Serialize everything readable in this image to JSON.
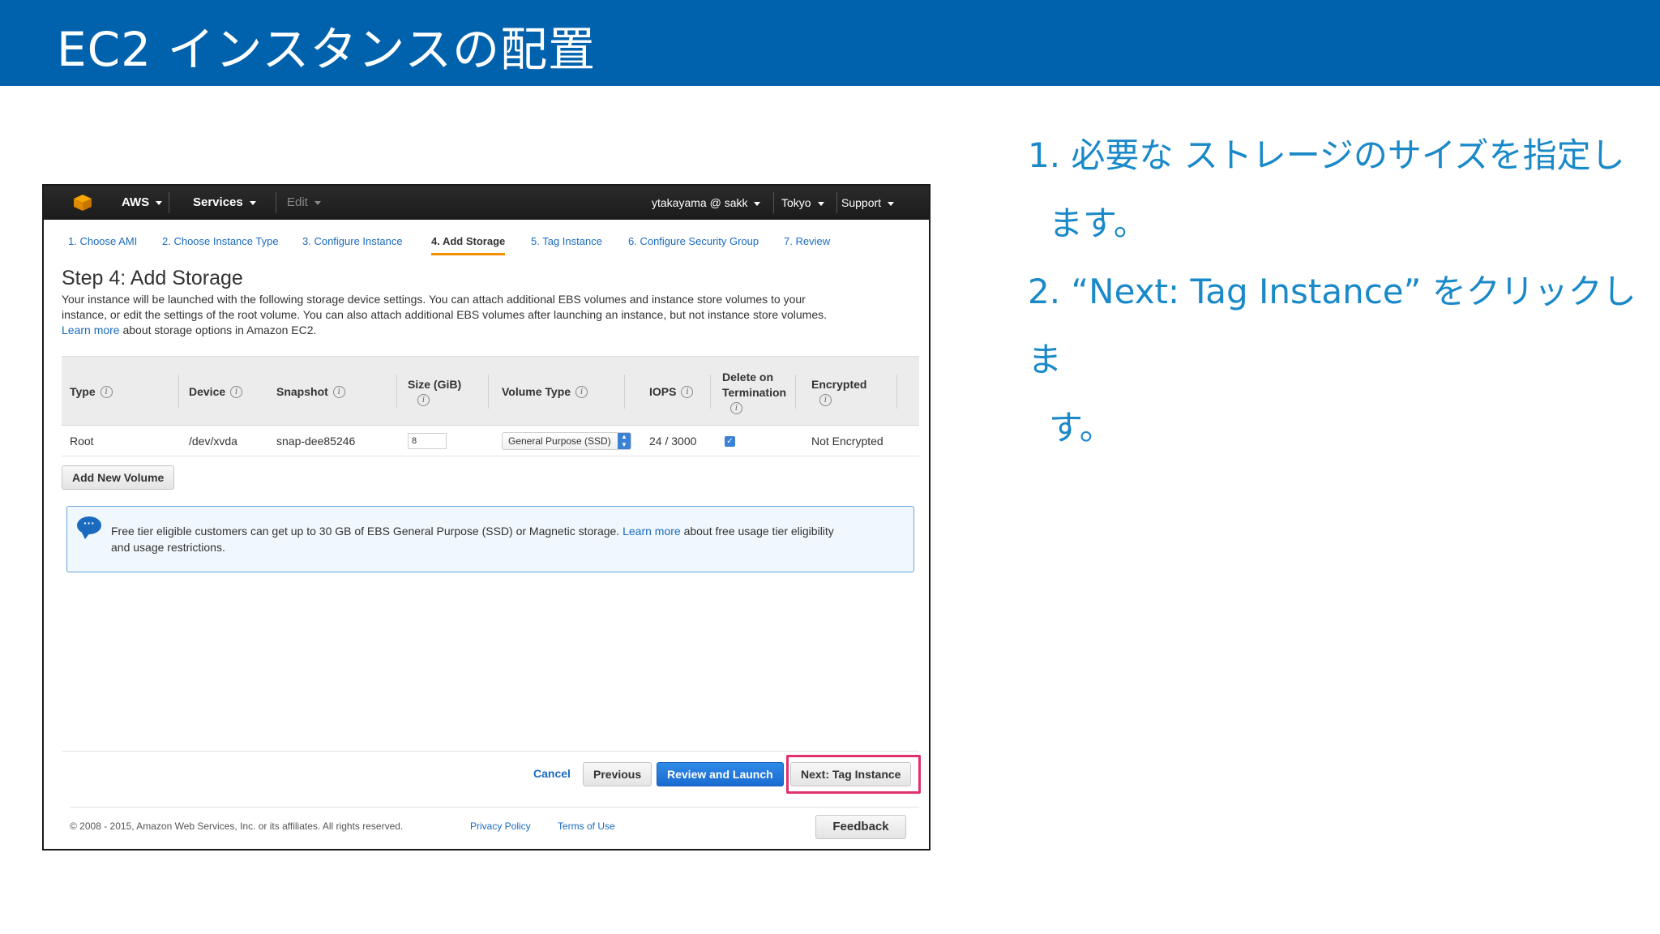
{
  "slide": {
    "title": "EC2 インスタンスの配置",
    "steps": [
      {
        "line1": "1. 必要な ストレージのサイズを指定し",
        "line2": "ます。"
      },
      {
        "line1": "2. “Next: Tag Instance” をクリックしま",
        "line2": "す。"
      }
    ]
  },
  "nav": {
    "aws": "AWS",
    "services": "Services",
    "edit": "Edit",
    "user": "ytakayama @ sakk",
    "region": "Tokyo",
    "support": "Support"
  },
  "wizard": {
    "tabs": [
      "1. Choose AMI",
      "2. Choose Instance Type",
      "3. Configure Instance",
      "4. Add Storage",
      "5. Tag Instance",
      "6. Configure Security Group",
      "7. Review"
    ],
    "active_tab": "4. Add Storage"
  },
  "page": {
    "step_title": "Step 4: Add Storage",
    "desc_line1": "Your instance will be launched with the following storage device settings. You can attach additional EBS volumes and instance store volumes to your",
    "desc_line2": "instance, or edit the settings of the root volume. You can also attach additional EBS volumes after launching an instance, but not instance store volumes.",
    "learn_more": "Learn more",
    "desc_line3": "about storage options in Amazon EC2."
  },
  "table": {
    "headers": {
      "type": "Type",
      "device": "Device",
      "snapshot": "Snapshot",
      "size": "Size (GiB)",
      "volume_type": "Volume Type",
      "iops": "IOPS",
      "delete_on_termination_1": "Delete on",
      "delete_on_termination_2": "Termination",
      "encrypted": "Encrypted"
    },
    "row": {
      "type": "Root",
      "device": "/dev/xvda",
      "snapshot": "snap-dee85246",
      "size": "8",
      "volume_type": "General Purpose (SSD)",
      "iops": "24 / 3000",
      "delete_on_termination": true,
      "encrypted": "Not Encrypted"
    }
  },
  "add_volume_label": "Add New Volume",
  "info": {
    "text1": "Free tier eligible customers can get up to 30 GB of EBS General Purpose (SSD) or Magnetic storage.",
    "learn_more": "Learn more",
    "text2": "about free usage tier eligibility",
    "text3": "and usage restrictions."
  },
  "actions": {
    "cancel": "Cancel",
    "previous": "Previous",
    "review_launch": "Review and Launch",
    "next": "Next: Tag Instance"
  },
  "footer": {
    "copyright": "© 2008 - 2015, Amazon Web Services, Inc. or its affiliates. All rights reserved.",
    "privacy": "Privacy Policy",
    "terms": "Terms of Use",
    "feedback": "Feedback"
  },
  "colors": {
    "title_bar": "#0062ad",
    "instruction_text": "#1a89c8",
    "highlight": "#e0306d",
    "primary_button": "#1a6bd1"
  }
}
